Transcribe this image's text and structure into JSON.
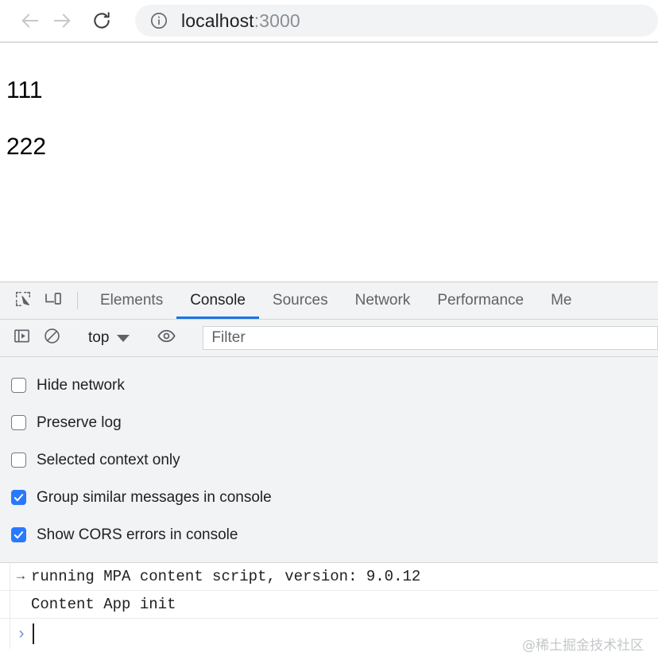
{
  "browser": {
    "back_icon": "arrow-left-icon",
    "forward_icon": "arrow-right-icon",
    "reload_icon": "reload-icon",
    "omnibox": {
      "info_icon": "info-circle-icon",
      "url_host": "localhost",
      "url_port": ":3000",
      "full_url": "localhost:3000"
    }
  },
  "page": {
    "paragraphs": [
      "111",
      "222"
    ]
  },
  "devtools": {
    "toolbar_icons": [
      {
        "name": "inspect-element-icon"
      },
      {
        "name": "device-toolbar-icon"
      }
    ],
    "tabs": [
      {
        "label": "Elements",
        "active": false
      },
      {
        "label": "Console",
        "active": true
      },
      {
        "label": "Sources",
        "active": false
      },
      {
        "label": "Network",
        "active": false
      },
      {
        "label": "Performance",
        "active": false
      },
      {
        "label": "Me",
        "active": false
      }
    ],
    "active_tab_underline_color": "#1a73e8",
    "console_toolbar": {
      "sidebar_toggle_icon": "console-sidebar-icon",
      "clear_console_icon": "clear-console-icon",
      "context_value": "top",
      "context_caret_icon": "chevron-down-icon",
      "live_expression_icon": "eye-icon",
      "filter_placeholder": "Filter"
    },
    "settings": [
      {
        "label": "Hide network",
        "checked": false
      },
      {
        "label": "Preserve log",
        "checked": false
      },
      {
        "label": "Selected context only",
        "checked": false
      },
      {
        "label": "Group similar messages in console",
        "checked": true
      },
      {
        "label": "Show CORS errors in console",
        "checked": true
      }
    ],
    "checked_color": "#2979ff",
    "messages": [
      {
        "arrow": "→",
        "text": "running MPA content script, version: 9.0.12"
      },
      {
        "arrow": "",
        "text": "Content App init"
      }
    ],
    "prompt": {
      "chevron": "›"
    }
  },
  "watermark": "@稀土掘金技术社区"
}
